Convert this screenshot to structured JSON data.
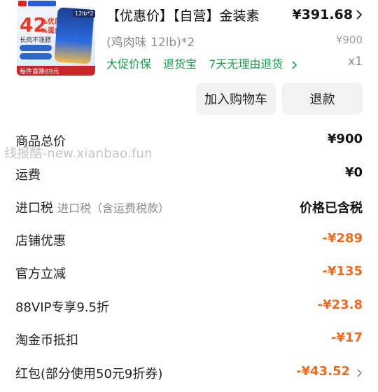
{
  "product": {
    "thumb": {
      "big_number": "42",
      "pct_line1": "%优质高",
      "pct_line2": "%蛋白",
      "line3": "长肉不涨膘",
      "badge": "12lb*2",
      "promo": "每件直降89元"
    },
    "title": "【优惠价】【自营】金装素",
    "price": "¥391.68",
    "spec": "(鸡肉味 12lb)*2",
    "spec_price": "¥900",
    "services": [
      "大促价保",
      "退货宝",
      "7天无理由退货"
    ],
    "quantity": "x1"
  },
  "buttons": {
    "add_to_cart": "加入购物车",
    "refund": "退款"
  },
  "watermark": "线报酷-new.xianbao.fun",
  "summary": [
    {
      "label": "商品总价",
      "sub": "",
      "value": "¥900",
      "tone": "black",
      "chevron": false
    },
    {
      "label": "运费",
      "sub": "",
      "value": "¥0",
      "tone": "black",
      "chevron": false
    },
    {
      "label": "进口税",
      "sub": "进口税（含运费税款）",
      "value": "价格已含税",
      "tone": "black",
      "chevron": false
    },
    {
      "label": "店铺优惠",
      "sub": "",
      "value": "-¥289",
      "tone": "orange",
      "chevron": false
    },
    {
      "label": "官方立减",
      "sub": "",
      "value": "-¥135",
      "tone": "orange",
      "chevron": false
    },
    {
      "label": "88VIP专享9.5折",
      "sub": "",
      "value": "-¥23.8",
      "tone": "orange",
      "chevron": false
    },
    {
      "label": "淘金币抵扣",
      "sub": "",
      "value": "-¥17",
      "tone": "orange",
      "chevron": false
    },
    {
      "label": "红包(部分使用50元9折券)",
      "sub": "",
      "value": "-¥43.52",
      "tone": "orange",
      "chevron": true
    }
  ],
  "colors": {
    "service_green": "#1c9a4e",
    "discount_orange": "#ee6a1e",
    "button_bg": "#f2f2f2"
  }
}
